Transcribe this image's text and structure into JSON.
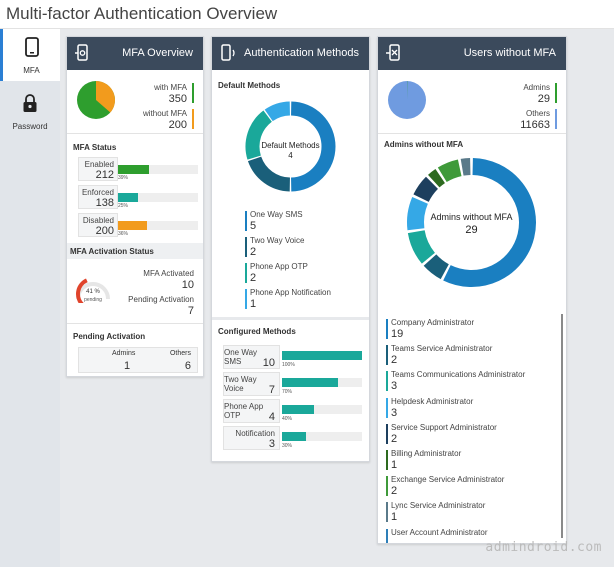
{
  "page": {
    "title": "Multi-factor Authentication Overview",
    "watermark": "admindroid.com"
  },
  "sidebar": {
    "items": [
      {
        "label": "MFA",
        "icon": "phone-icon",
        "active": true
      },
      {
        "label": "Password",
        "icon": "lock-icon",
        "active": false
      }
    ]
  },
  "colors": {
    "header": "#3b4a5c",
    "green": "#2e9e2e",
    "orange": "#f29b1d",
    "teal": "#1aa89a",
    "blue": "#1a7fc1",
    "accent": "#2a7fd4"
  },
  "mfa_overview": {
    "header": "MFA Overview",
    "icon": "device-settings-icon",
    "with_mfa_label": "with MFA",
    "with_mfa_value": "350",
    "without_mfa_label": "without MFA",
    "without_mfa_value": "200",
    "status_title": "MFA Status",
    "status": [
      {
        "label": "Enabled",
        "value": "212",
        "pct": "39%",
        "fill": 0.39,
        "color": "#2e9e2e"
      },
      {
        "label": "Enforced",
        "value": "138",
        "pct": "25%",
        "fill": 0.25,
        "color": "#1aa89a"
      },
      {
        "label": "Disabled",
        "value": "200",
        "pct": "36%",
        "fill": 0.36,
        "color": "#f29b1d"
      }
    ],
    "activation_title": "MFA Activation Status",
    "activation_pct": "41 %",
    "activation_pct_sub": "pending",
    "activated_label": "MFA Activated",
    "activated_value": "10",
    "pending_label": "Pending Activation",
    "pending_value": "7",
    "pending_title": "Pending Activation",
    "pending_admins_label": "Admins",
    "pending_admins_value": "1",
    "pending_others_label": "Others",
    "pending_others_value": "6"
  },
  "auth_methods": {
    "header": "Authentication Methods",
    "icon": "phone-signal-icon",
    "default_title": "Default Methods",
    "donut_label": "Default Methods",
    "donut_value": "4",
    "methods": [
      {
        "label": "One Way SMS",
        "value": "5",
        "color": "#1a7fc1"
      },
      {
        "label": "Two Way Voice",
        "value": "2",
        "color": "#1a5f7a"
      },
      {
        "label": "Phone App OTP",
        "value": "2",
        "color": "#1aa89a"
      },
      {
        "label": "Phone App Notification",
        "value": "1",
        "color": "#35a8e6"
      }
    ],
    "configured_title": "Configured Methods",
    "configured": [
      {
        "label": "One Way SMS",
        "value": "10",
        "pct": "100%",
        "fill": 1.0
      },
      {
        "label": "Two Way Voice",
        "value": "7",
        "pct": "70%",
        "fill": 0.7
      },
      {
        "label": "Phone App OTP",
        "value": "4",
        "pct": "40%",
        "fill": 0.4
      },
      {
        "label": "Notification",
        "value": "3",
        "pct": "30%",
        "fill": 0.3
      }
    ]
  },
  "users_without_mfa": {
    "header": "Users without MFA",
    "icon": "device-x-icon",
    "admins_label": "Admins",
    "admins_value": "29",
    "others_label": "Others",
    "others_value": "11663",
    "admins_title": "Admins without MFA",
    "donut_label": "Admins without MFA",
    "donut_value": "29",
    "roles": [
      {
        "label": "Company Administrator",
        "value": "19",
        "color": "#1a7fc1"
      },
      {
        "label": "Teams Service Administrator",
        "value": "2",
        "color": "#1a5f7a"
      },
      {
        "label": "Teams Communications Administrator",
        "value": "3",
        "color": "#1aa89a"
      },
      {
        "label": "Helpdesk Administrator",
        "value": "3",
        "color": "#35a8e6"
      },
      {
        "label": "Service Support Administrator",
        "value": "2",
        "color": "#1d3f5e"
      },
      {
        "label": "Billing Administrator",
        "value": "1",
        "color": "#2d6a1f"
      },
      {
        "label": "Exchange Service Administrator",
        "value": "2",
        "color": "#3f9a3a"
      },
      {
        "label": "Lync Service Administrator",
        "value": "1",
        "color": "#5a7a8a"
      },
      {
        "label": "User Account Administrator",
        "value": "",
        "color": "#2e7fb8"
      }
    ]
  },
  "chart_data": [
    {
      "type": "pie",
      "title": "",
      "categories": [
        "with MFA",
        "without MFA"
      ],
      "values": [
        350,
        200
      ]
    },
    {
      "type": "pie",
      "title": "Default Methods",
      "categories": [
        "One Way SMS",
        "Two Way Voice",
        "Phone App OTP",
        "Phone App Notification"
      ],
      "values": [
        5,
        2,
        2,
        1
      ]
    },
    {
      "type": "bar",
      "title": "Configured Methods",
      "categories": [
        "One Way SMS",
        "Two Way Voice",
        "Phone App OTP",
        "Notification"
      ],
      "values": [
        10,
        7,
        4,
        3
      ]
    },
    {
      "type": "pie",
      "title": "",
      "categories": [
        "Admins",
        "Others"
      ],
      "values": [
        29,
        11663
      ]
    },
    {
      "type": "pie",
      "title": "Admins without MFA",
      "categories": [
        "Company Administrator",
        "Teams Service Administrator",
        "Teams Communications Administrator",
        "Helpdesk Administrator",
        "Service Support Administrator",
        "Billing Administrator",
        "Exchange Service Administrator",
        "Lync Service Administrator"
      ],
      "values": [
        19,
        2,
        3,
        3,
        2,
        1,
        2,
        1
      ]
    }
  ]
}
